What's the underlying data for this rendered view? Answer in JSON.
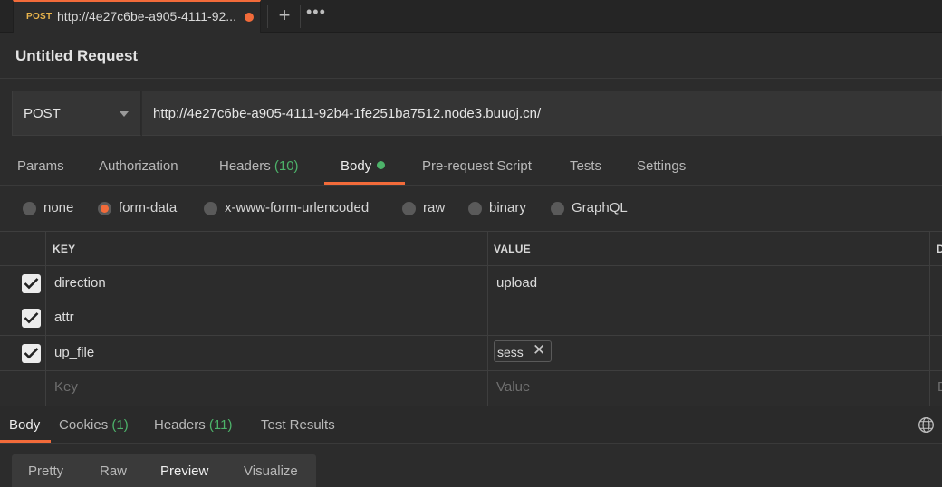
{
  "tab": {
    "method": "POST",
    "title": "http://4e27c6be-a905-4111-92...",
    "plus": "+",
    "more": "•••"
  },
  "request": {
    "title": "Untitled Request",
    "method": "POST",
    "url": "http://4e27c6be-a905-4111-92b4-1fe251ba7512.node3.buuoj.cn/"
  },
  "request_tabs": [
    {
      "label": "Params"
    },
    {
      "label": "Authorization"
    },
    {
      "label": "Headers",
      "count": "(10)"
    },
    {
      "label": "Body"
    },
    {
      "label": "Pre-request Script"
    },
    {
      "label": "Tests"
    },
    {
      "label": "Settings"
    }
  ],
  "body_types": [
    {
      "label": "none",
      "selected": false
    },
    {
      "label": "form-data",
      "selected": true
    },
    {
      "label": "x-www-form-urlencoded",
      "selected": false
    },
    {
      "label": "raw",
      "selected": false
    },
    {
      "label": "binary",
      "selected": false
    },
    {
      "label": "GraphQL",
      "selected": false
    }
  ],
  "table": {
    "headers": {
      "key": "KEY",
      "value": "VALUE",
      "desc": "D"
    },
    "rows": [
      {
        "checked": true,
        "key": "direction",
        "value": "upload"
      },
      {
        "checked": true,
        "key": "attr",
        "value": ""
      },
      {
        "checked": true,
        "key": "up_file",
        "file": "sess"
      }
    ],
    "placeholder": {
      "key": "Key",
      "value": "Value",
      "desc": "D"
    }
  },
  "response_tabs": [
    {
      "label": "Body"
    },
    {
      "label": "Cookies",
      "count": "(1)"
    },
    {
      "label": "Headers",
      "count": "(11)"
    },
    {
      "label": "Test Results"
    }
  ],
  "view_modes": [
    "Pretty",
    "Raw",
    "Preview",
    "Visualize"
  ],
  "active_view": "Preview",
  "colors": {
    "accent": "#f26b3a",
    "count_green": "#4db36a",
    "method_yellow": "#e9b44c"
  }
}
